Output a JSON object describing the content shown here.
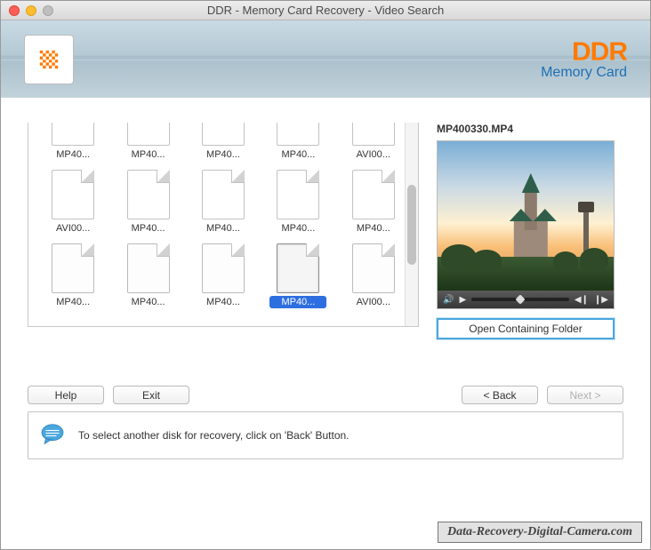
{
  "window": {
    "title": "DDR - Memory Card Recovery - Video Search"
  },
  "brand": {
    "ddr": "DDR",
    "sub": "Memory Card"
  },
  "files": [
    {
      "label": "MP40...",
      "selected": false
    },
    {
      "label": "MP40...",
      "selected": false
    },
    {
      "label": "MP40...",
      "selected": false
    },
    {
      "label": "MP40...",
      "selected": false
    },
    {
      "label": "AVI00...",
      "selected": false
    },
    {
      "label": "AVI00...",
      "selected": false
    },
    {
      "label": "MP40...",
      "selected": false
    },
    {
      "label": "MP40...",
      "selected": false
    },
    {
      "label": "MP40...",
      "selected": false
    },
    {
      "label": "MP40...",
      "selected": false
    },
    {
      "label": "MP40...",
      "selected": false
    },
    {
      "label": "MP40...",
      "selected": false
    },
    {
      "label": "MP40...",
      "selected": false
    },
    {
      "label": "MP40...",
      "selected": true
    },
    {
      "label": "AVI00...",
      "selected": false
    }
  ],
  "preview": {
    "filename": "MP400330.MP4",
    "open_folder": "Open Containing Folder"
  },
  "buttons": {
    "help": "Help",
    "exit": "Exit",
    "back": "< Back",
    "next": "Next >"
  },
  "info": {
    "text": "To select another disk for recovery, click on 'Back' Button."
  },
  "watermark": "Data-Recovery-Digital-Camera.com"
}
